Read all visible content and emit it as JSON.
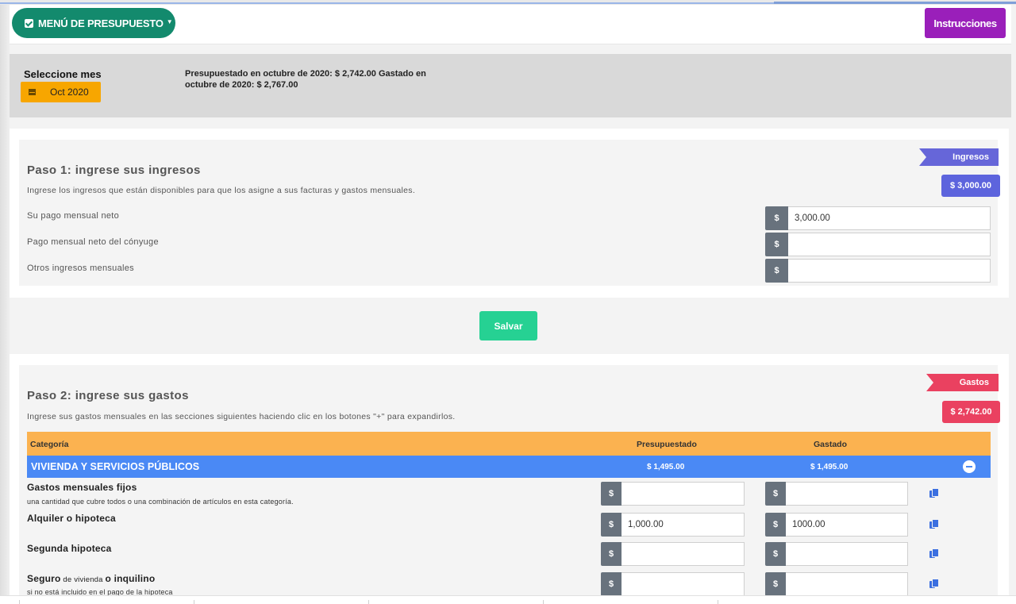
{
  "header": {
    "menu_label": "MENÚ DE PRESUPUESTO",
    "instructions_label": "Instrucciones"
  },
  "month": {
    "label": "Seleccione mes",
    "value": "Oct 2020",
    "summary": "Presupuestado en octubre de 2020: $ 2,742.00 Gastado en octubre de 2020: $ 2,767.00"
  },
  "step1": {
    "ribbon": "Ingresos",
    "total": "$ 3,000.00",
    "title": "Paso 1: ingrese sus ingresos",
    "description": "Ingrese los ingresos que están disponibles para que los asigne a sus facturas y gastos mensuales.",
    "currency_symbol": "$",
    "rows": [
      {
        "label": "Su pago mensual neto",
        "value": "3,000.00"
      },
      {
        "label": "Pago mensual neto del cónyuge",
        "value": ""
      },
      {
        "label": "Otros ingresos mensuales",
        "value": ""
      }
    ]
  },
  "save_label": "Salvar",
  "step2": {
    "ribbon": "Gastos",
    "total": "$ 2,742.00",
    "title": "Paso 2: ingrese sus gastos",
    "description": "Ingrese sus gastos mensuales en las secciones siguientes haciendo clic en los botones \"+\" para expandirlos.",
    "columns": {
      "category": "Categoría",
      "budgeted": "Presupuestado",
      "spent": "Gastado"
    },
    "category": {
      "name": "VIVIENDA Y SERVICIOS PÚBLICOS",
      "budgeted": "$ 1,495.00",
      "spent": "$ 1,495.00"
    },
    "rows": [
      {
        "name": "Gastos mensuales fijos",
        "name_small": "",
        "name_tail": "",
        "sub": "una cantidad que cubre todos o una combinación de artículos en esta categoría.",
        "budgeted": "",
        "spent": ""
      },
      {
        "name": "Alquiler o hipoteca",
        "name_small": "",
        "name_tail": "",
        "sub": "",
        "budgeted": "1,000.00",
        "spent": "1000.00"
      },
      {
        "name": "Segunda hipoteca",
        "name_small": "",
        "name_tail": "",
        "sub": "",
        "budgeted": "",
        "spent": ""
      },
      {
        "name": "Seguro",
        "name_small": " de vivienda ",
        "name_tail": "o inquilino",
        "sub": "si no está incluido en el pago de la hipoteca",
        "budgeted": "",
        "spent": ""
      }
    ]
  }
}
